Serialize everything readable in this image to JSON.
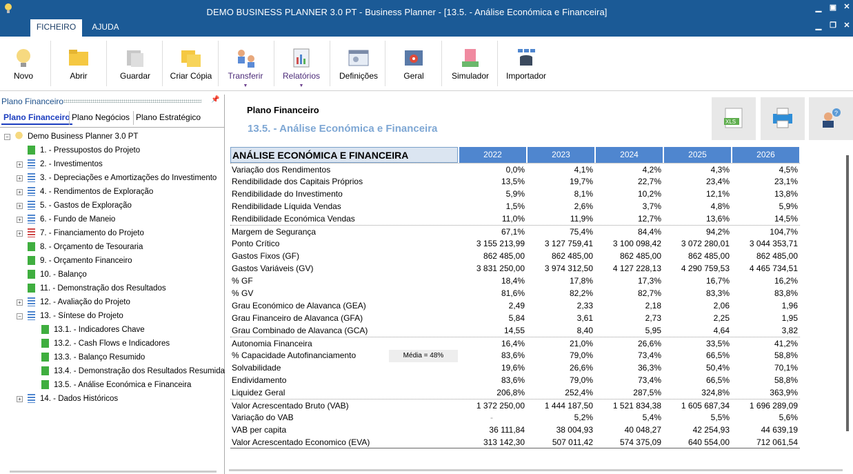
{
  "window": {
    "title": "DEMO BUSINESS PLANNER 3.0 PT - Business Planner - [13.5. - Análise Económica e Financeira]"
  },
  "menu_tabs": [
    {
      "label": "FICHEIRO"
    },
    {
      "label": "AJUDA"
    }
  ],
  "ribbon": [
    {
      "label": "Novo",
      "icon": "lightbulb-icon"
    },
    {
      "label": "Abrir",
      "icon": "folder-open-icon"
    },
    {
      "label": "Guardar",
      "icon": "save-icon"
    },
    {
      "label": "Criar Cópia",
      "icon": "copy-folder-icon"
    },
    {
      "label": "Transferir",
      "icon": "transfer-users-icon"
    },
    {
      "label": "Relatórios",
      "icon": "reports-icon"
    },
    {
      "label": "Definições",
      "icon": "settings-window-icon"
    },
    {
      "label": "Geral",
      "icon": "gear-icon"
    },
    {
      "label": "Simulador",
      "icon": "calculator-money-icon"
    },
    {
      "label": "Importador",
      "icon": "database-import-icon"
    }
  ],
  "left_panel": {
    "title": "Plano Financeiro",
    "tabs": [
      {
        "label": "Plano Financeiro"
      },
      {
        "label": "Plano Negócios"
      },
      {
        "label": "Plano Estratégico"
      }
    ],
    "tree": [
      {
        "label": "Demo Business Planner 3.0 PT"
      },
      {
        "label": "1. - Pressupostos do Projeto"
      },
      {
        "label": "2. - Investimentos"
      },
      {
        "label": "3. - Depreciações e Amortizações do Investimento"
      },
      {
        "label": "4. - Rendimentos de Exploração"
      },
      {
        "label": "5. - Gastos de Exploração"
      },
      {
        "label": "6. - Fundo de Maneio"
      },
      {
        "label": "7. - Financiamento do Projeto"
      },
      {
        "label": "8. - Orçamento de Tesouraria"
      },
      {
        "label": "9. - Orçamento Financeiro"
      },
      {
        "label": "10. - Balanço"
      },
      {
        "label": "11. - Demonstração dos Resultados"
      },
      {
        "label": "12. - Avaliação do Projeto"
      },
      {
        "label": "13. - Síntese do Projeto"
      },
      {
        "label": "13.1. - Indicadores Chave"
      },
      {
        "label": "13.2. - Cash Flows e Indicadores"
      },
      {
        "label": "13.3. - Balanço Resumido"
      },
      {
        "label": "13.4. - Demonstração dos Resultados Resumida"
      },
      {
        "label": "13.5. - Análise Económica e Financeira"
      },
      {
        "label": "14. - Dados Históricos"
      }
    ]
  },
  "main": {
    "header_title": "Plano Financeiro",
    "header_subtitle": "13.5. - Análise Económica e Financeira",
    "export_icons": [
      "excel-export-icon",
      "print-icon",
      "help-user-icon"
    ],
    "table": {
      "title": "ANÁLISE ECONÓMICA E FINANCEIRA",
      "years": [
        "2022",
        "2023",
        "2024",
        "2025",
        "2026"
      ],
      "rows": [
        {
          "label": "Variação dos Rendimentos",
          "values": [
            "0,0%",
            "4,1%",
            "4,2%",
            "4,3%",
            "4,5%"
          ]
        },
        {
          "label": "Rendibilidade dos Capitais Próprios",
          "values": [
            "13,5%",
            "19,7%",
            "22,7%",
            "23,4%",
            "23,1%"
          ]
        },
        {
          "label": "Rendibilidade do Investimento",
          "values": [
            "5,9%",
            "8,1%",
            "10,2%",
            "12,1%",
            "13,8%"
          ]
        },
        {
          "label": "Rendibilidade Líquida Vendas",
          "values": [
            "1,5%",
            "2,6%",
            "3,7%",
            "4,8%",
            "5,9%"
          ]
        },
        {
          "label": "Rendibilidade Económica Vendas",
          "values": [
            "11,0%",
            "11,9%",
            "12,7%",
            "13,6%",
            "14,5%"
          ]
        },
        {
          "label": "Margem de Segurança",
          "values": [
            "67,1%",
            "75,4%",
            "84,4%",
            "94,2%",
            "104,7%"
          ]
        },
        {
          "label": "Ponto Crítico",
          "values": [
            "3 155 213,99",
            "3 127 759,41",
            "3 100 098,42",
            "3 072 280,01",
            "3 044 353,71"
          ]
        },
        {
          "label": "Gastos Fixos (GF)",
          "values": [
            "862 485,00",
            "862 485,00",
            "862 485,00",
            "862 485,00",
            "862 485,00"
          ]
        },
        {
          "label": "Gastos Variáveis (GV)",
          "values": [
            "3 831 250,00",
            "3 974 312,50",
            "4 127 228,13",
            "4 290 759,53",
            "4 465 734,51"
          ]
        },
        {
          "label": "% GF",
          "values": [
            "18,4%",
            "17,8%",
            "17,3%",
            "16,7%",
            "16,2%"
          ]
        },
        {
          "label": "% GV",
          "values": [
            "81,6%",
            "82,2%",
            "82,7%",
            "83,3%",
            "83,8%"
          ]
        },
        {
          "label": "Grau Económico de Alavanca (GEA)",
          "values": [
            "2,49",
            "2,33",
            "2,18",
            "2,06",
            "1,96"
          ]
        },
        {
          "label": "Grau Financeiro de Alavanca (GFA)",
          "values": [
            "5,84",
            "3,61",
            "2,73",
            "2,25",
            "1,95"
          ]
        },
        {
          "label": "Grau Combinado de Alavanca (GCA)",
          "values": [
            "14,55",
            "8,40",
            "5,95",
            "4,64",
            "3,82"
          ]
        },
        {
          "label": "Autonomia Financeira",
          "values": [
            "16,4%",
            "21,0%",
            "26,6%",
            "33,5%",
            "41,2%"
          ]
        },
        {
          "label": "% Capacidade Autofinanciamento",
          "values": [
            "83,6%",
            "79,0%",
            "73,4%",
            "66,5%",
            "58,8%"
          ]
        },
        {
          "label": "Solvabilidade",
          "values": [
            "19,6%",
            "26,6%",
            "36,3%",
            "50,4%",
            "70,1%"
          ]
        },
        {
          "label": "Endividamento",
          "values": [
            "83,6%",
            "79,0%",
            "73,4%",
            "66,5%",
            "58,8%"
          ]
        },
        {
          "label": "Liquidez Geral",
          "values": [
            "206,8%",
            "252,4%",
            "287,5%",
            "324,8%",
            "363,9%"
          ]
        },
        {
          "label": "Valor Acrescentado Bruto (VAB)",
          "values": [
            "1 372 250,00",
            "1 444 187,50",
            "1 521 834,38",
            "1 605 687,34",
            "1 696 289,09"
          ]
        },
        {
          "label": "Variação do VAB",
          "values": [
            "-",
            "5,2%",
            "5,4%",
            "5,5%",
            "5,6%"
          ]
        },
        {
          "label": "VAB per capita",
          "values": [
            "36 111,84",
            "38 004,93",
            "40 048,27",
            "42 254,93",
            "44 639,19"
          ]
        },
        {
          "label": "Valor Acrescentado Economico (EVA)",
          "values": [
            "313 142,30",
            "507 011,42",
            "574 375,09",
            "640 554,00",
            "712 061,54"
          ]
        }
      ],
      "tooltip": "Média = 48%"
    }
  }
}
